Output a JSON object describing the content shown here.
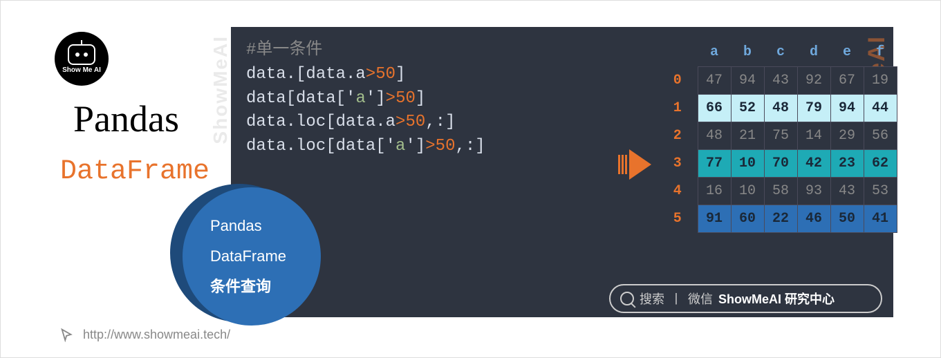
{
  "logo": {
    "text": "Show Me AI"
  },
  "titles": {
    "main": "Pandas",
    "sub": "DataFrame"
  },
  "watermark": "ShowMeAI",
  "badge": {
    "line1": "Pandas",
    "line2": "DataFrame",
    "line3": "条件查询"
  },
  "code": {
    "comment": "#单一条件",
    "lines": [
      {
        "pre": "data.[data.a",
        "op": ">",
        "num": "50",
        "post": "]"
      },
      {
        "pre": "data[data['",
        "str": "a",
        "mid": "']",
        "op": ">",
        "num": "50",
        "post": "]"
      },
      {
        "pre": "data.loc[data.a",
        "op": ">",
        "num": "50",
        "post": ",:]"
      },
      {
        "pre": "data.loc[data['",
        "str": "a",
        "mid": "']",
        "op": ">",
        "num": "50",
        "post": ",:]"
      }
    ]
  },
  "chart_data": {
    "type": "table",
    "columns": [
      "a",
      "b",
      "c",
      "d",
      "e",
      "f"
    ],
    "index": [
      "0",
      "1",
      "2",
      "3",
      "4",
      "5"
    ],
    "rows": [
      {
        "values": [
          47,
          94,
          43,
          92,
          67,
          19
        ],
        "highlight": "dim"
      },
      {
        "values": [
          66,
          52,
          48,
          79,
          94,
          44
        ],
        "highlight": "light"
      },
      {
        "values": [
          48,
          21,
          75,
          14,
          29,
          56
        ],
        "highlight": "dim"
      },
      {
        "values": [
          77,
          10,
          70,
          42,
          23,
          62
        ],
        "highlight": "teal"
      },
      {
        "values": [
          16,
          10,
          58,
          93,
          43,
          53
        ],
        "highlight": "dim"
      },
      {
        "values": [
          91,
          60,
          22,
          46,
          50,
          41
        ],
        "highlight": "blue"
      }
    ],
    "condition": "a > 50"
  },
  "search": {
    "action": "搜索",
    "sep": "丨",
    "channel": "微信",
    "brand": "ShowMeAI 研究中心"
  },
  "footer": {
    "url": "http://www.showmeai.tech/"
  }
}
